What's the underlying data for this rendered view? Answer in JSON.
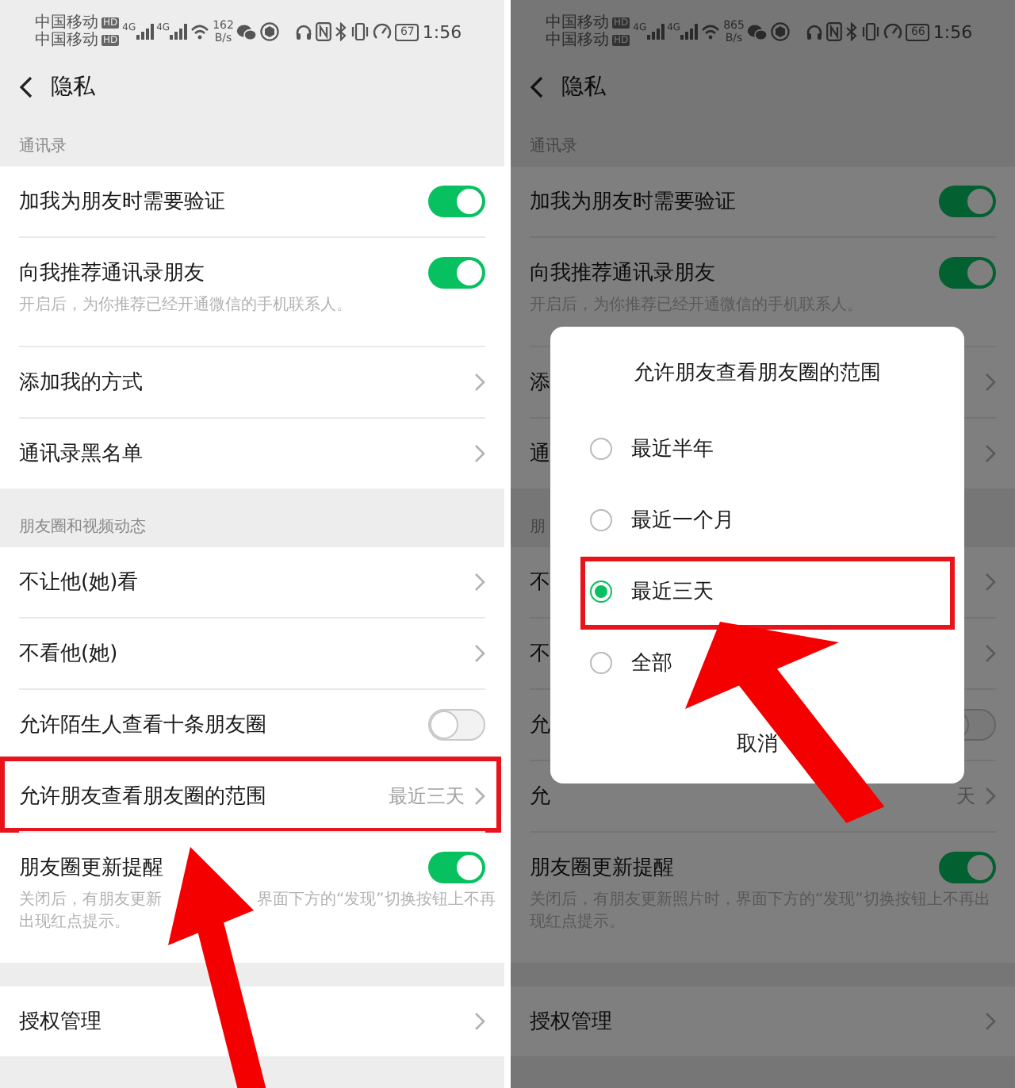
{
  "panels": [
    {
      "status_bar": {
        "carriers": [
          {
            "name": "中国移动",
            "badge": "HD",
            "network": "4G"
          },
          {
            "name": "中国移动",
            "badge": "HD",
            "network": "4G"
          }
        ],
        "speed": "162",
        "speed_unit": "B/s",
        "battery": "67",
        "time": "1:56"
      },
      "title": "隐私",
      "sections": [
        {
          "header": "通讯录",
          "rows": [
            {
              "kind": "toggle",
              "label": "加我为朋友时需要验证",
              "on": true,
              "highlighted": false
            },
            {
              "kind": "toggle",
              "label": "向我推荐通讯录朋友",
              "on": true,
              "highlighted": false,
              "note": [
                "开启后，为你推荐已经开通微信的手机联系人。"
              ]
            },
            {
              "kind": "link",
              "label": "添加我的方式",
              "highlighted": false
            },
            {
              "kind": "link",
              "label": "通讯录黑名单",
              "highlighted": false
            }
          ]
        },
        {
          "header": "朋友圈和视频动态",
          "rows": [
            {
              "kind": "link",
              "label": "不让他(她)看",
              "highlighted": false
            },
            {
              "kind": "link",
              "label": "不看他(她)",
              "highlighted": false
            },
            {
              "kind": "toggle",
              "label": "允许陌生人查看十条朋友圈",
              "on": false,
              "highlighted": false
            },
            {
              "kind": "link",
              "label": "允许朋友查看朋友圈的范围",
              "value": "最近三天",
              "highlighted": true
            },
            {
              "kind": "toggle",
              "label": "朋友圈更新提醒",
              "on": true,
              "highlighted": false,
              "note": [
                "关闭后，有朋友更新",
                "界面下方的“发现”切换按钮上不再",
                "出现红点提示。"
              ]
            }
          ]
        },
        {
          "rows": [
            {
              "kind": "link",
              "label": "授权管理",
              "highlighted": false
            }
          ]
        }
      ]
    },
    {
      "status_bar": {
        "carriers": [
          {
            "name": "中国移动",
            "badge": "HD",
            "network": "4G"
          },
          {
            "name": "中国移动",
            "badge": "HD",
            "network": "4G"
          }
        ],
        "speed": "865",
        "speed_unit": "B/s",
        "battery": "66",
        "time": "1:56"
      },
      "title": "隐私",
      "sections": [
        {
          "header": "通讯录",
          "rows": [
            {
              "kind": "toggle",
              "label": "加我为朋友时需要验证",
              "on": true,
              "highlighted": false
            },
            {
              "kind": "toggle",
              "label": "向我推荐通讯录朋友",
              "on": true,
              "highlighted": false,
              "note": [
                "开启后，为你推荐已经开通微信的手机联系人。"
              ]
            },
            {
              "kind": "link",
              "label": "添",
              "highlighted": false
            },
            {
              "kind": "link",
              "label": "通",
              "highlighted": false
            }
          ]
        },
        {
          "header": "朋",
          "rows": [
            {
              "kind": "link",
              "label": "不",
              "highlighted": false
            },
            {
              "kind": "link",
              "label": "不",
              "highlighted": false
            },
            {
              "kind": "toggle",
              "label": "允",
              "on": false,
              "highlighted": false
            },
            {
              "kind": "link",
              "label": "允",
              "value": "天",
              "highlighted": false
            },
            {
              "kind": "toggle",
              "label": "朋友圈更新提醒",
              "on": true,
              "highlighted": false,
              "note": [
                "关闭后，有朋友更新照片时，界面下方的“发现”切换按钮上不再出现红点提示。"
              ]
            }
          ]
        },
        {
          "rows": [
            {
              "kind": "link",
              "label": "授权管理",
              "highlighted": false
            }
          ]
        }
      ],
      "dialog": {
        "title": "允许朋友查看朋友圈的范围",
        "options": [
          {
            "label": "最近半年",
            "selected": false
          },
          {
            "label": "最近一个月",
            "selected": false
          },
          {
            "label": "最近三天",
            "selected": true,
            "highlighted": true
          },
          {
            "label": "全部",
            "selected": false
          }
        ],
        "cancel": "取消"
      }
    }
  ]
}
